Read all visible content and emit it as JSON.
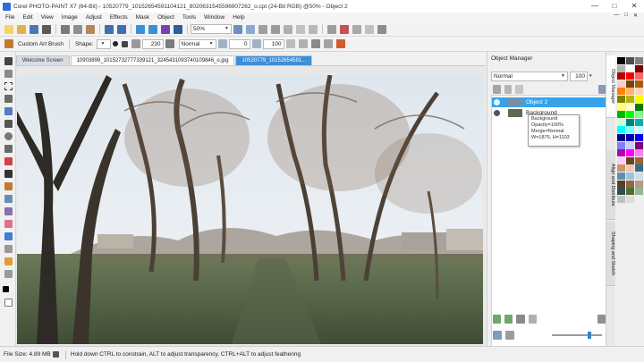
{
  "window": {
    "title": "Corel PHOTO-PAINT X7 (64-Bit) - 10520779_10152654591104121_8020631545596907262_o.cpt (24-Bit RGB) @50% - Object 2",
    "minimize": "—",
    "maximize": "□",
    "close": "✕"
  },
  "menu": {
    "items": [
      "File",
      "Edit",
      "View",
      "Image",
      "Adjust",
      "Effects",
      "Mask",
      "Object",
      "Tools",
      "Window",
      "Help"
    ],
    "mdi_controls": [
      "—",
      "□",
      "✕"
    ]
  },
  "standard_toolbar": {
    "zoom_value": "50%"
  },
  "property_bar": {
    "brush_label": "Custom Art Brush",
    "shape_label": "Shape:",
    "size_value": "230",
    "merge_mode": "Normal",
    "transparency_value": "0",
    "opacity_value": "100"
  },
  "document_tabs": [
    {
      "label": "Welcome Screen"
    },
    {
      "label": "10903899_10152732777339121_3245431093740109846_o.jpg"
    },
    {
      "label": "10520779_10152654591..."
    }
  ],
  "object_manager": {
    "title": "Object Manager",
    "merge_mode": "Normal",
    "opacity": "100",
    "objects": [
      {
        "name": "Object 2",
        "selected": true
      },
      {
        "name": "Background",
        "selected": false
      }
    ],
    "tooltip": {
      "line1": "Background",
      "line2": "Opacity=100%",
      "line3": "Merge=Normal",
      "line4": "W=1875, H=1103"
    }
  },
  "docker_tabs": [
    "Object Manager",
    "Align and Distribute",
    "Shaping and Sketch"
  ],
  "palette": {
    "colors": [
      "#000000",
      "#4d4d4d",
      "#808080",
      "#b3b3b3",
      "#ffffff",
      "#7f0000",
      "#b30000",
      "#ff0000",
      "#ff6666",
      "#ffcccc",
      "#804000",
      "#b35900",
      "#ff8000",
      "#ffb366",
      "#ffd9b3",
      "#808000",
      "#b3b300",
      "#ffff00",
      "#ffff80",
      "#ffffcc",
      "#008000",
      "#00b300",
      "#00ff00",
      "#80ff80",
      "#ccffcc",
      "#008080",
      "#00b3b3",
      "#00ffff",
      "#80ffff",
      "#ccffff",
      "#000080",
      "#0000b3",
      "#0000ff",
      "#8080ff",
      "#ccccff",
      "#800080",
      "#b300b3",
      "#ff00ff",
      "#ff80ff",
      "#ffccff",
      "#664422",
      "#996633",
      "#cc9966",
      "#e6ccb3",
      "#3a6b8c",
      "#5b8fb3",
      "#9ec3dd",
      "#c9dfee",
      "#5a3d2b",
      "#8a6a4f",
      "#b89a7e",
      "#2f4f4f",
      "#556b2f",
      "#8fbc8f",
      "#c0c0c0",
      "#dcdcdc"
    ]
  },
  "status": {
    "file_size": "File Size: 4.89 MB",
    "hint": "Hold down CTRL to constrain, ALT to adjust transparency, CTRL+ALT to adjust feathering"
  }
}
